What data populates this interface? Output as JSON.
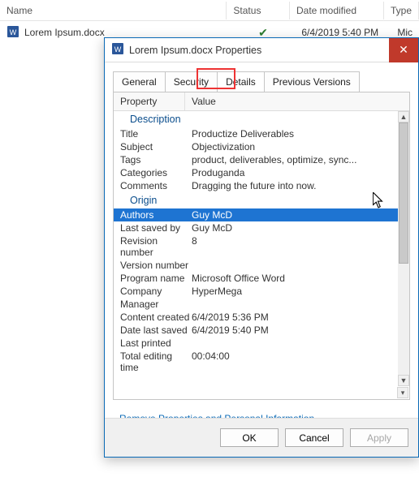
{
  "explorer": {
    "columns": {
      "name": "Name",
      "status": "Status",
      "date": "Date modified",
      "type": "Type"
    },
    "file": {
      "name": "Lorem Ipsum.docx",
      "date": "6/4/2019 5:40 PM",
      "type": "Mic"
    }
  },
  "dialog": {
    "title": "Lorem Ipsum.docx Properties",
    "tabs": {
      "general": "General",
      "security": "Security",
      "details": "Details",
      "previous": "Previous Versions"
    },
    "grid_headers": {
      "property": "Property",
      "value": "Value"
    },
    "sections": {
      "description": {
        "header": "Description",
        "rows": [
          {
            "p": "Title",
            "v": "Productize Deliverables"
          },
          {
            "p": "Subject",
            "v": "Objectivization"
          },
          {
            "p": "Tags",
            "v": "product, deliverables, optimize, sync..."
          },
          {
            "p": "Categories",
            "v": "Produganda"
          },
          {
            "p": "Comments",
            "v": "Dragging the future into now."
          }
        ]
      },
      "origin": {
        "header": "Origin",
        "rows": [
          {
            "p": "Authors",
            "v": "Guy McD",
            "selected": true
          },
          {
            "p": "Last saved by",
            "v": "Guy McD"
          },
          {
            "p": "Revision number",
            "v": "8"
          },
          {
            "p": "Version number",
            "v": ""
          },
          {
            "p": "Program name",
            "v": "Microsoft Office Word"
          },
          {
            "p": "Company",
            "v": "HyperMega"
          },
          {
            "p": "Manager",
            "v": ""
          },
          {
            "p": "Content created",
            "v": "6/4/2019 5:36 PM"
          },
          {
            "p": "Date last saved",
            "v": "6/4/2019 5:40 PM"
          },
          {
            "p": "Last printed",
            "v": ""
          },
          {
            "p": "Total editing time",
            "v": "00:04:00"
          }
        ]
      }
    },
    "remove_link": "Remove Properties and Personal Information",
    "buttons": {
      "ok": "OK",
      "cancel": "Cancel",
      "apply": "Apply"
    }
  }
}
